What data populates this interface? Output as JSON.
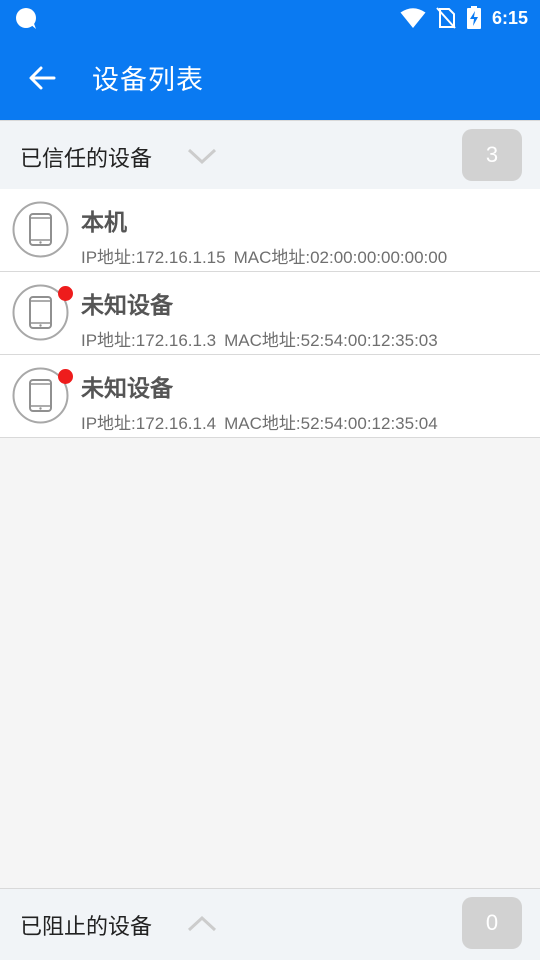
{
  "status_bar": {
    "time": "6:15",
    "icons": [
      "app-notification-icon",
      "wifi-icon",
      "no-sim-icon",
      "battery-charging-icon"
    ]
  },
  "header": {
    "title": "设备列表",
    "back_icon": "arrow-left-icon"
  },
  "trusted_section": {
    "label": "已信任的设备",
    "count": "3",
    "chevron_icon": "chevron-down-icon"
  },
  "devices": [
    {
      "name": "本机",
      "ip": "IP地址:172.16.1.15",
      "mac": "MAC地址:02:00:00:00:00:00",
      "alert": false
    },
    {
      "name": "未知设备",
      "ip": "IP地址:172.16.1.3",
      "mac": "MAC地址:52:54:00:12:35:03",
      "alert": true
    },
    {
      "name": "未知设备",
      "ip": "IP地址:172.16.1.4",
      "mac": "MAC地址:52:54:00:12:35:04",
      "alert": true
    }
  ],
  "blocked_section": {
    "label": "已阻止的设备",
    "count": "0",
    "chevron_icon": "chevron-up-icon"
  },
  "colors": {
    "primary": "#0a7af2",
    "section_bg": "#f1f4f7",
    "badge_bg": "#d2d2d2",
    "alert": "#ee1c1c"
  }
}
